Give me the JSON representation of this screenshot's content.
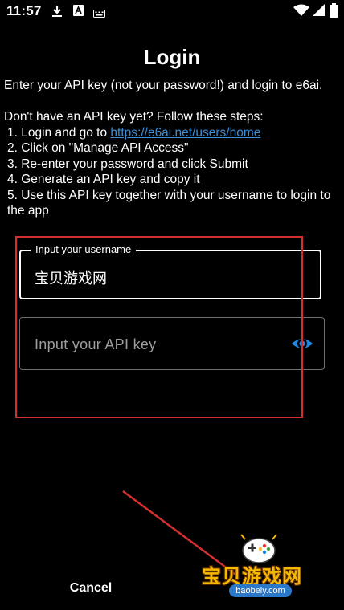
{
  "status_bar": {
    "time": "11:57",
    "icons": [
      "download-icon",
      "font-app-icon",
      "keyboard-icon",
      "wifi-icon",
      "cellular-icon",
      "battery-icon"
    ]
  },
  "dialog": {
    "title": "Login",
    "intro": "Enter your API key (not your password!) and login to e6ai.",
    "steps_heading": "Don't have an API key yet? Follow these steps:",
    "step1_prefix": "1. Login and go to ",
    "step1_link": "https://e6ai.net/users/home",
    "step2": "2. Click on \"Manage API Access\"",
    "step3": "3. Re-enter your password and click Submit",
    "step4": "4. Generate an API key and copy it",
    "step5": "5. Use this API key together with your username to login to the app",
    "link_color": "#3d8fd6"
  },
  "form": {
    "username_label": "Input your username",
    "username_value": "宝贝游戏网",
    "apikey_placeholder": "Input your API key",
    "visibility_icon": "eye-icon",
    "visibility_color": "#1e88e5"
  },
  "buttons": {
    "cancel": "Cancel"
  },
  "watermark": {
    "title": "宝贝游戏网",
    "domain": "baobeiy.com"
  },
  "annotation_color": "#d32f2f"
}
